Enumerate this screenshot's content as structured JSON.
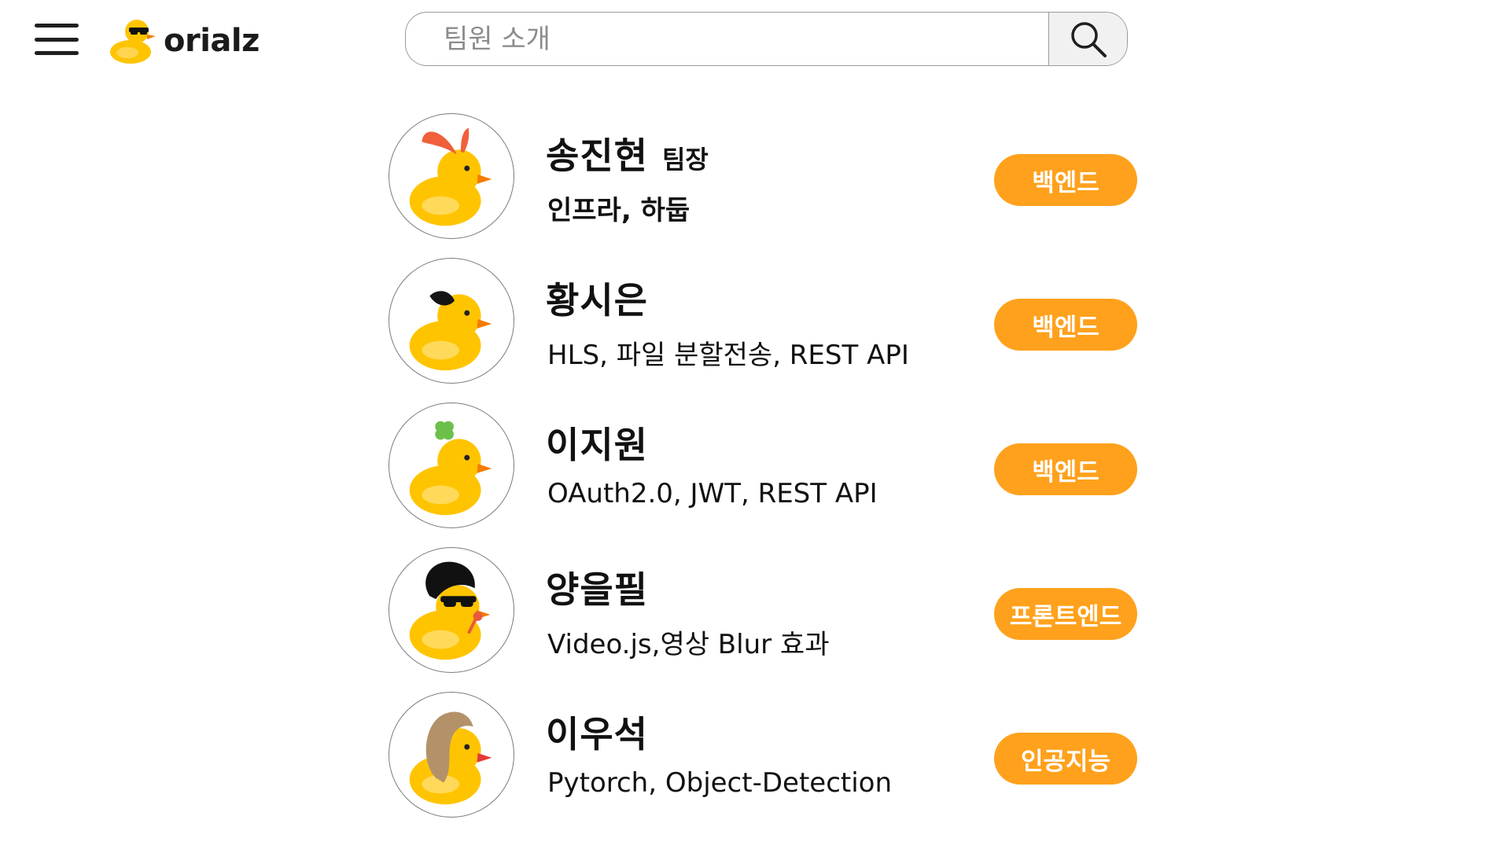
{
  "header": {
    "logo_text": "orialz",
    "logo_icon": "duck-with-sunglasses-icon",
    "menu_icon": "hamburger-menu-icon",
    "search": {
      "value": "",
      "placeholder": "팀원 소개",
      "icon": "search-icon"
    }
  },
  "colors": {
    "accent": "#ffa11c",
    "duck": "#ffc400",
    "text": "#111111"
  },
  "members": [
    {
      "name": "송진현",
      "role": "팀장",
      "skills": "인프라, 하둡",
      "team": "백엔드",
      "avatar_icon": "duck-bunny-ear-icon"
    },
    {
      "name": "황시은",
      "role": "",
      "skills": "HLS, 파일 분할전송, REST API",
      "team": "백엔드",
      "avatar_icon": "duck-black-bow-icon"
    },
    {
      "name": "이지원",
      "role": "",
      "skills": "OAuth2.0, JWT, REST API",
      "team": "백엔드",
      "avatar_icon": "duck-clover-icon"
    },
    {
      "name": "양을필",
      "role": "",
      "skills": "Video.js,영상 Blur 효과",
      "team": "프론트엔드",
      "avatar_icon": "duck-afro-sunglasses-icon"
    },
    {
      "name": "이우석",
      "role": "",
      "skills": "Pytorch, Object-Detection",
      "team": "인공지능",
      "avatar_icon": "duck-long-hair-icon"
    }
  ]
}
